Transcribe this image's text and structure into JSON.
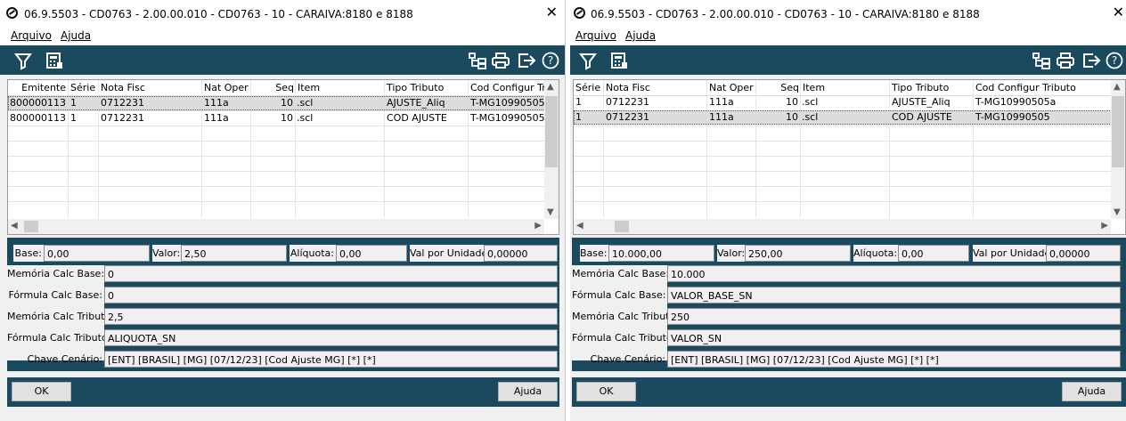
{
  "window_title": "06.9.5503 - CD0763 - 2.00.00.010 - CD0763 - 10 - CARAIVA:8180 e 8188",
  "menu": {
    "arquivo": "Arquivo",
    "ajuda": "Ajuda"
  },
  "left": {
    "columns": [
      "Emitente",
      "Série",
      "Nota Fisc",
      "Nat Oper",
      "Seq",
      "Item",
      "Tipo Tributo",
      "Cod Configur Tributo"
    ],
    "rows": [
      [
        "800000113",
        "1",
        "0712231",
        "111a",
        "10",
        ".scl",
        "AJUSTE_Aliq",
        "T-MG10990505"
      ],
      [
        "800000113",
        "1",
        "0712231",
        "111a",
        "10",
        ".scl",
        "COD AJUSTE",
        "T-MG10990505"
      ]
    ],
    "labels": {
      "base": "Base:",
      "valor": "Valor:",
      "aliquota": "Alíquota:",
      "val_unid": "Val por Unidade:",
      "mem_base": "Memória Calc Base:",
      "form_base": "Fórmula Calc Base:",
      "mem_trib": "Memória Calc Tributo:",
      "form_trib": "Fórmula Calc Tributo:",
      "chave": "Chave Cenário:"
    },
    "fields": {
      "base": "0,00",
      "valor": "2,50",
      "aliquota": "0,00",
      "val_unid": "0,00000",
      "mem_base": "0",
      "form_base": "0",
      "mem_trib": "2,5",
      "form_trib": "ALIQUOTA_SN",
      "chave": "[ENT] [BRASIL] [MG] [07/12/23] [Cod Ajuste MG] [*] [*]"
    },
    "buttons": {
      "ok": "OK",
      "ajuda": "Ajuda"
    }
  },
  "right": {
    "columns": [
      "Série",
      "Nota Fisc",
      "Nat Oper",
      "Seq",
      "Item",
      "Tipo Tributo",
      "Cod Configur Tributo"
    ],
    "rows": [
      [
        "1",
        "0712231",
        "111a",
        "10",
        ".scl",
        "AJUSTE_Aliq",
        "T-MG10990505a"
      ],
      [
        "1",
        "0712231",
        "111a",
        "10",
        ".scl",
        "COD AJUSTE",
        "T-MG10990505"
      ]
    ],
    "labels": {
      "base": "Base:",
      "valor": "Valor:",
      "aliquota": "Alíquota:",
      "val_unid": "Val por Unidade:",
      "mem_base": "Memória Calc Base:",
      "form_base": "Fórmula Calc Base:",
      "mem_trib": "Memória Calc Tributo:",
      "form_trib": "Fórmula Calc Tributo:",
      "chave": "Chave Cenário:"
    },
    "fields": {
      "base": "10.000,00",
      "valor": "250,00",
      "aliquota": "0,00",
      "val_unid": "0,00000",
      "mem_base": "10.000",
      "form_base": "VALOR_BASE_SN",
      "mem_trib": "250",
      "form_trib": "VALOR_SN",
      "chave": "[ENT] [BRASIL] [MG] [07/12/23] [Cod Ajuste MG] [*] [*]"
    },
    "buttons": {
      "ok": "OK",
      "ajuda": "Ajuda"
    }
  },
  "colors": {
    "toolbar": "#1b4a5e",
    "window_bg": "#f0f0f0"
  },
  "icons": [
    "app-icon",
    "close-icon",
    "filter-icon",
    "calculator-icon",
    "tree-icon",
    "print-icon",
    "exit-icon",
    "help-icon"
  ]
}
